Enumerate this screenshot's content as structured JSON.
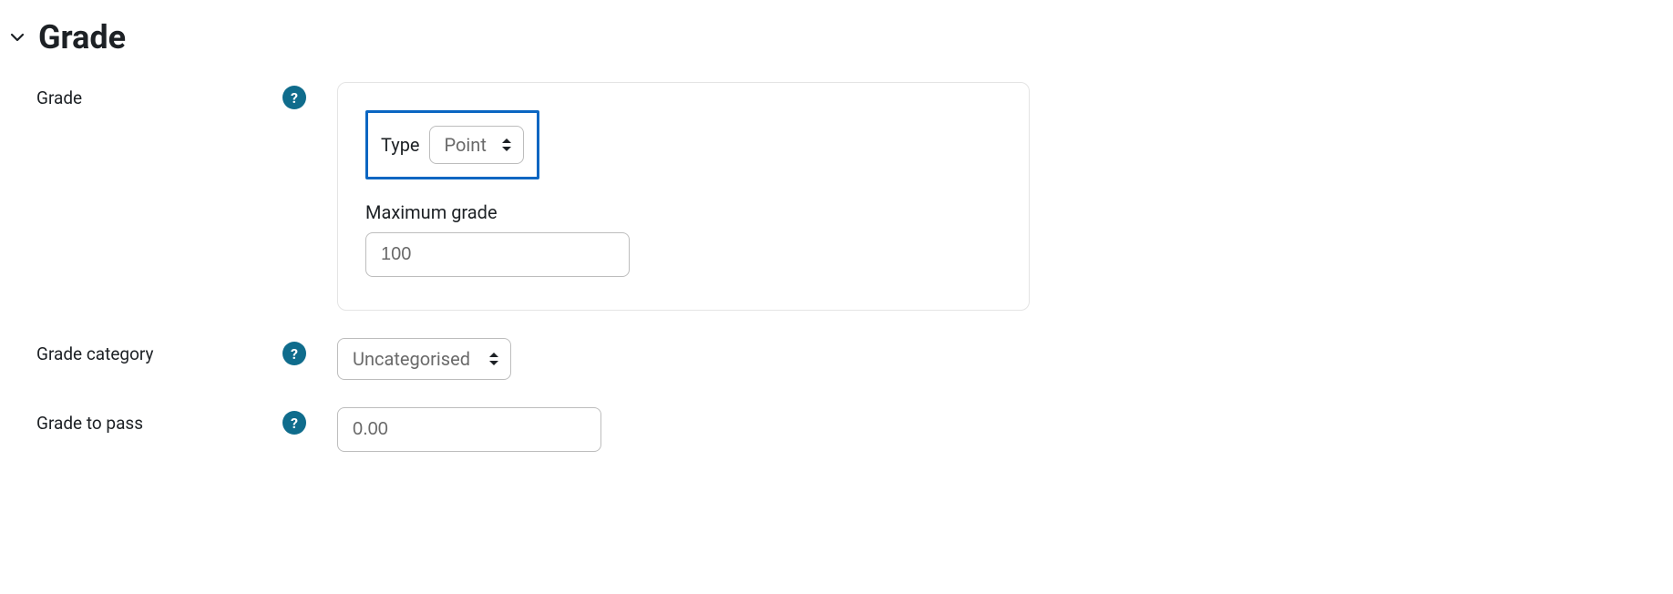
{
  "section": {
    "title": "Grade"
  },
  "grade": {
    "label": "Grade",
    "typeLabel": "Type",
    "typeValue": "Point",
    "maxLabel": "Maximum grade",
    "maxValue": "100"
  },
  "category": {
    "label": "Grade category",
    "value": "Uncategorised"
  },
  "pass": {
    "label": "Grade to pass",
    "value": "0.00"
  },
  "help": {
    "symbol": "?"
  }
}
